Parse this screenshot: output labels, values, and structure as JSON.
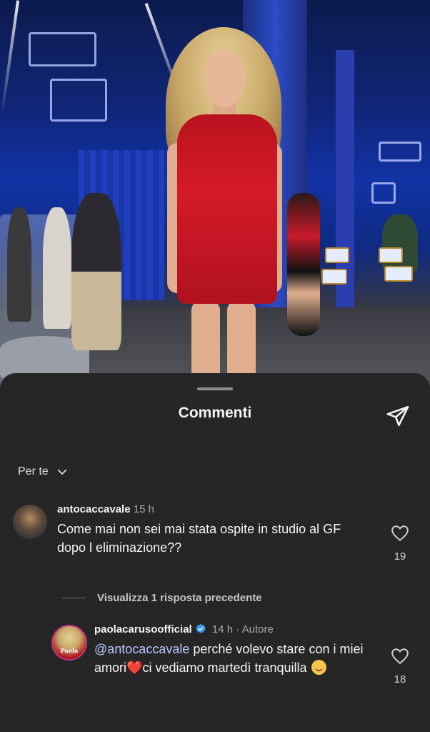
{
  "sheet": {
    "title": "Commenti",
    "filter_label": "Per te"
  },
  "comments": [
    {
      "username": "antocaccavale",
      "time": "15 h",
      "text": "Come mai non sei mai stata ospite in studio al GF dopo l eliminazione??",
      "likes": "19"
    }
  ],
  "replies_toggle": "Visualizza 1 risposta precedente",
  "reply": {
    "username": "paolacarusoofficial",
    "time": "14 h",
    "separator": "·",
    "badge": "Autore",
    "mention": "@antocaccavale",
    "text_part1": " perché volevo stare con i miei amori",
    "text_part2": "ci vediamo martedì tranquilla",
    "likes": "18",
    "avatar_label": "Paola"
  },
  "icons": {
    "share": "paper-plane-icon",
    "filter": "chevron-down-icon",
    "like": "heart-outline-icon",
    "verified": "verified-badge-icon"
  },
  "colors": {
    "sheet_bg": "#262626",
    "verified": "#3897f0",
    "mention": "#b9c7ff",
    "heart_emoji": "#e0202f"
  }
}
